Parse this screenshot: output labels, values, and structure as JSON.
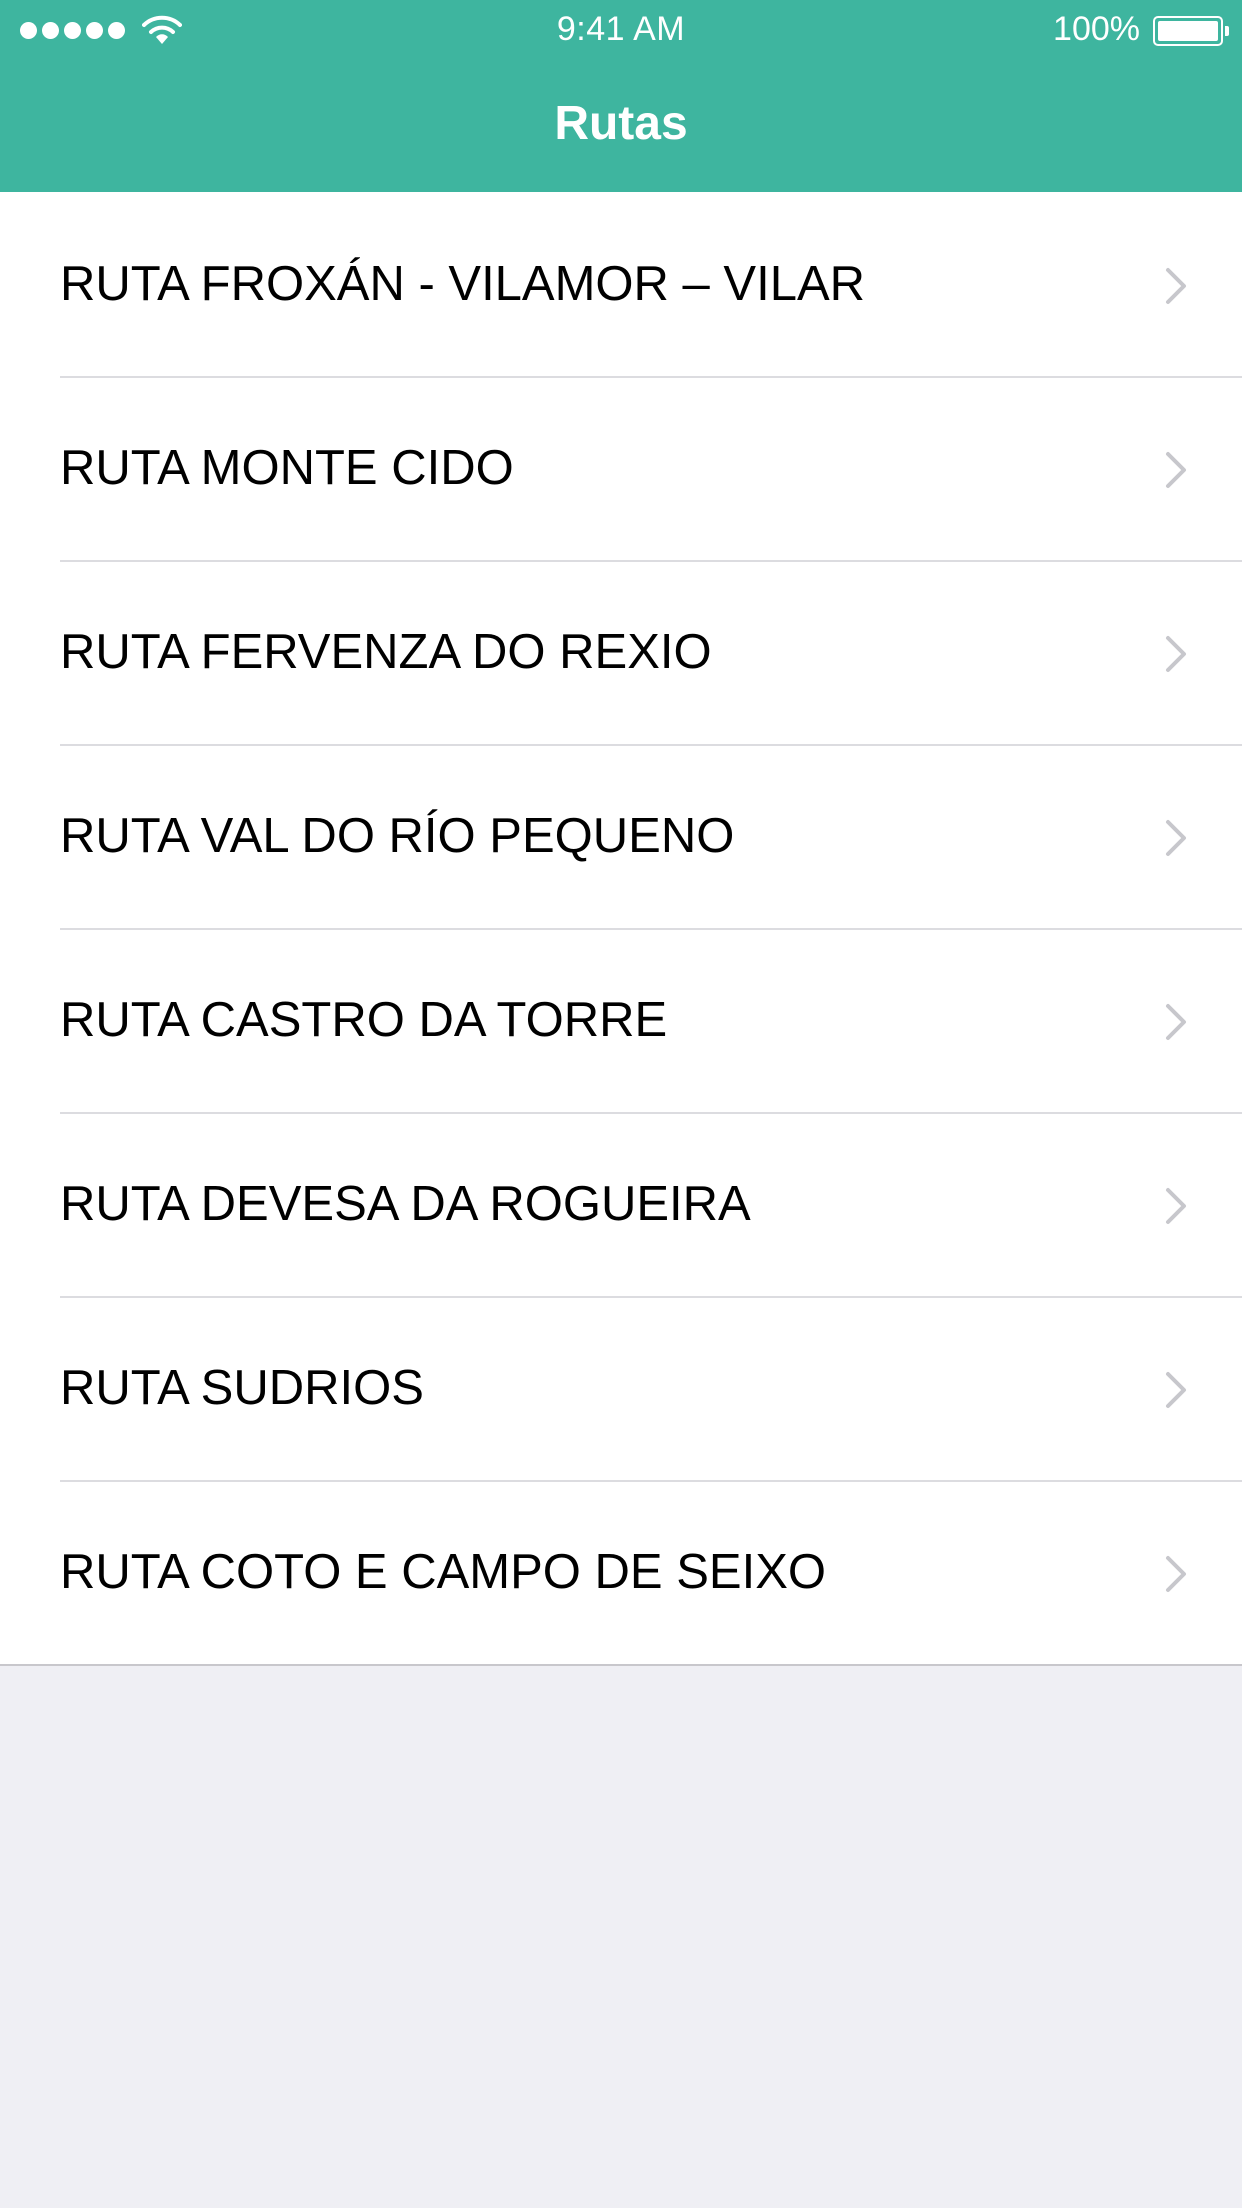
{
  "status_bar": {
    "time": "9:41 AM",
    "battery_percent": "100%",
    "signal_bars": 5,
    "signal_icon": "signal-dots-icon",
    "wifi_icon": "wifi-icon",
    "battery_icon": "battery-icon"
  },
  "nav": {
    "title": "Rutas"
  },
  "routes": [
    {
      "label": "RUTA FROXÁN - VILAMOR – VILAR"
    },
    {
      "label": "RUTA MONTE CIDO"
    },
    {
      "label": "RUTA FERVENZA DO REXIO"
    },
    {
      "label": "RUTA VAL DO RÍO PEQUENO"
    },
    {
      "label": "RUTA CASTRO DA TORRE"
    },
    {
      "label": "RUTA DEVESA DA ROGUEIRA"
    },
    {
      "label": "RUTA SUDRIOS"
    },
    {
      "label": "RUTA COTO E CAMPO DE SEIXO"
    }
  ],
  "row_icon": "chevron-right-icon",
  "colors": {
    "accent": "#3eb59f",
    "background": "#efeff4",
    "row_background": "#ffffff",
    "separator": "#dcdce0",
    "chevron": "#c7c7cc"
  }
}
